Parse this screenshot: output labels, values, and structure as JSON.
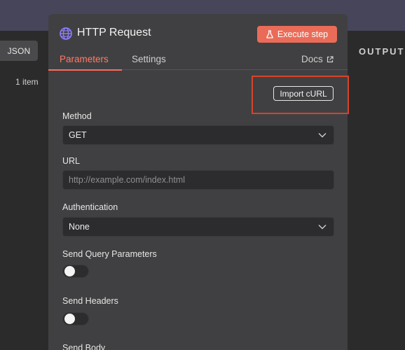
{
  "background": {
    "json_button": "JSON",
    "item_count": "1 item",
    "output_label": "OUTPUT"
  },
  "modal": {
    "title": "HTTP Request",
    "icon": "globe-icon",
    "execute_button": "Execute step",
    "tabs": {
      "parameters": "Parameters",
      "settings": "Settings",
      "docs": "Docs"
    },
    "import_curl": "Import cURL",
    "fields": {
      "method": {
        "label": "Method",
        "value": "GET"
      },
      "url": {
        "label": "URL",
        "placeholder": "http://example.com/index.html"
      },
      "authentication": {
        "label": "Authentication",
        "value": "None"
      },
      "send_query": {
        "label": "Send Query Parameters",
        "on": false
      },
      "send_headers": {
        "label": "Send Headers",
        "on": false
      },
      "send_body": {
        "label": "Send Body"
      }
    }
  },
  "colors": {
    "accent": "#ea6c58",
    "tab_active": "#ff7b66",
    "highlight_box": "#d6442a",
    "modal_bg": "#404042"
  }
}
